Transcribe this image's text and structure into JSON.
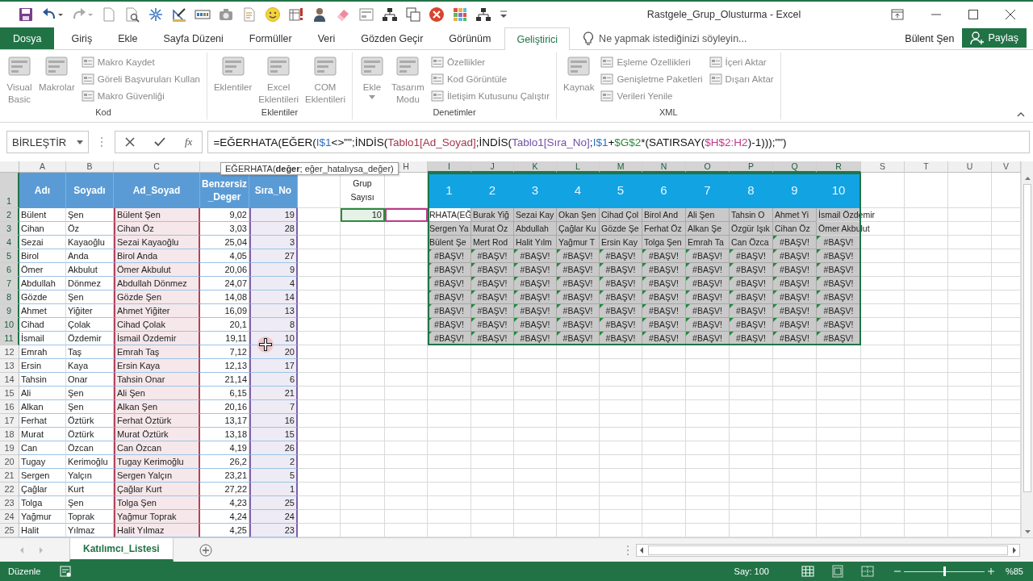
{
  "window": {
    "title": "Rastgele_Grup_Olusturma - Excel",
    "user": "Bülent Şen",
    "share_button": "Paylaş"
  },
  "ribbon_tabs": [
    {
      "label": "Dosya",
      "kind": "file",
      "selected": false
    },
    {
      "label": "Giriş",
      "kind": "tab",
      "selected": false
    },
    {
      "label": "Ekle",
      "kind": "tab",
      "selected": false
    },
    {
      "label": "Sayfa Düzeni",
      "kind": "tab",
      "selected": false
    },
    {
      "label": "Formüller",
      "kind": "tab",
      "selected": false
    },
    {
      "label": "Veri",
      "kind": "tab",
      "selected": false
    },
    {
      "label": "Gözden Geçir",
      "kind": "tab",
      "selected": false
    },
    {
      "label": "Görünüm",
      "kind": "tab",
      "selected": false
    },
    {
      "label": "Geliştirici",
      "kind": "tab",
      "selected": true
    }
  ],
  "tell_me": {
    "placeholder": "Ne yapmak istediğinizi söyleyin..."
  },
  "ribbon": {
    "disabled": true,
    "groups": [
      {
        "label": "Kod",
        "items": [
          {
            "kind": "large",
            "label": "Visual\nBasic",
            "menu": false
          },
          {
            "kind": "large",
            "label": "Makrolar",
            "menu": false
          },
          {
            "kind": "stack",
            "items": [
              {
                "label": "Makro Kaydet"
              },
              {
                "label": "Göreli Başvuruları Kullan"
              },
              {
                "label": "Makro Güvenliği"
              }
            ]
          }
        ]
      },
      {
        "label": "Eklentiler",
        "items": [
          {
            "kind": "large",
            "label": "Eklentiler",
            "menu": false
          },
          {
            "kind": "large",
            "label": "Excel\nEklentileri",
            "menu": false
          },
          {
            "kind": "large",
            "label": "COM\nEklentileri",
            "menu": false
          }
        ]
      },
      {
        "label": "Denetimler",
        "items": [
          {
            "kind": "large",
            "label": "Ekle",
            "menu": true
          },
          {
            "kind": "large",
            "label": "Tasarım\nModu",
            "menu": false
          },
          {
            "kind": "stack",
            "items": [
              {
                "label": "Özellikler"
              },
              {
                "label": "Kod Görüntüle"
              },
              {
                "label": "İletişim Kutusunu Çalıştır"
              }
            ]
          }
        ]
      },
      {
        "label": "XML",
        "items": [
          {
            "kind": "large",
            "label": "Kaynak",
            "menu": false
          },
          {
            "kind": "stack",
            "items": [
              {
                "label": "Eşleme Özellikleri"
              },
              {
                "label": "Genişletme Paketleri"
              },
              {
                "label": "Verileri Yenile"
              }
            ]
          },
          {
            "kind": "stack",
            "items": [
              {
                "label": "İçeri Aktar"
              },
              {
                "label": "Dışarı Aktar"
              }
            ]
          }
        ]
      }
    ]
  },
  "formula_bar": {
    "name_box": "BİRLEŞTİR",
    "function_button": "fx",
    "formula": [
      {
        "text": "=EĞERHATA(EĞER("
      },
      {
        "text": "I$1",
        "color": "#2e6fc0"
      },
      {
        "text": "<>\"\";İNDİS("
      },
      {
        "text": "Tablo1[Ad_Soyad]",
        "color": "#a3364e"
      },
      {
        "text": ";İNDİS("
      },
      {
        "text": "Tablo1[Sıra_No]",
        "color": "#7450a8"
      },
      {
        "text": ";"
      },
      {
        "text": "I$1",
        "color": "#2e6fc0"
      },
      {
        "text": "+"
      },
      {
        "text": "$G$2",
        "color": "#2d8a3c"
      },
      {
        "text": "*(SATIRSAY("
      },
      {
        "text": "$H$2:H2",
        "color": "#c0398a"
      },
      {
        "text": ")-1)));\"\")"
      }
    ]
  },
  "tooltip": "EĞERHATA(**değer**; eğer_hatalıysa_değer)",
  "sheet": {
    "columns": [
      {
        "label": "A",
        "selected": false
      },
      {
        "label": "B",
        "selected": false
      },
      {
        "label": "C",
        "selected": false
      },
      {
        "selected": false
      },
      {
        "selected": false
      },
      {
        "selected": false
      },
      {
        "selected": false
      },
      {
        "label": "H",
        "selected": false
      },
      {
        "label": "I",
        "selected": true
      },
      {
        "label": "J",
        "selected": true
      },
      {
        "label": "K",
        "selected": true
      },
      {
        "label": "L",
        "selected": true
      },
      {
        "label": "M",
        "selected": true
      },
      {
        "label": "N",
        "selected": true
      },
      {
        "label": "O",
        "selected": true
      },
      {
        "label": "P",
        "selected": true
      },
      {
        "label": "Q",
        "selected": true
      },
      {
        "label": "R",
        "selected": true
      },
      {
        "label": "S",
        "selected": false
      },
      {
        "label": "T",
        "selected": false
      },
      {
        "label": "U",
        "selected": false
      },
      {
        "label": "V",
        "selected": false
      }
    ],
    "rows": [
      {
        "label": "1",
        "selected": true
      },
      {
        "label": "2",
        "selected": true
      },
      {
        "label": "3",
        "selected": true
      },
      {
        "label": "4",
        "selected": true
      },
      {
        "label": "5",
        "selected": true
      },
      {
        "label": "6",
        "selected": true
      },
      {
        "label": "7",
        "selected": true
      },
      {
        "label": "8",
        "selected": true
      },
      {
        "label": "9",
        "selected": true
      },
      {
        "label": "10",
        "selected": true
      },
      {
        "label": "11",
        "selected": true
      },
      {
        "label": "12",
        "selected": false
      },
      {
        "label": "13",
        "selected": false
      },
      {
        "label": "14",
        "selected": false
      },
      {
        "label": "15",
        "selected": false
      },
      {
        "label": "16",
        "selected": false
      },
      {
        "label": "17",
        "selected": false
      },
      {
        "label": "18",
        "selected": false
      },
      {
        "label": "19",
        "selected": false
      },
      {
        "label": "20",
        "selected": false
      },
      {
        "label": "21",
        "selected": false
      },
      {
        "label": "22",
        "selected": false
      },
      {
        "label": "23",
        "selected": false
      },
      {
        "label": "24",
        "selected": false
      },
      {
        "label": "25",
        "selected": false
      }
    ],
    "table": {
      "headers": [
        {
          "text": "Adı"
        },
        {
          "text": "Soyadı"
        },
        {
          "text": "Ad_Soyad",
          "color": "#b2435a"
        },
        {
          "text": "Benzersiz\n_Deger"
        },
        {
          "text": "Sıra_No",
          "color": "#7e62ad"
        }
      ],
      "rows": [
        [
          "Bülent",
          "Şen",
          "Bülent Şen",
          "9,02",
          "19"
        ],
        [
          "Cihan",
          "Öz",
          "Cihan Öz",
          "3,03",
          "28"
        ],
        [
          "Sezai",
          "Kayaoğlu",
          "Sezai Kayaoğlu",
          "25,04",
          "3"
        ],
        [
          "Birol",
          "Anda",
          "Birol Anda",
          "4,05",
          "27"
        ],
        [
          "Ömer",
          "Akbulut",
          "Ömer Akbulut",
          "20,06",
          "9"
        ],
        [
          "Abdullah",
          "Dönmez",
          "Abdullah Dönmez",
          "24,07",
          "4"
        ],
        [
          "Gözde",
          "Şen",
          "Gözde Şen",
          "14,08",
          "14"
        ],
        [
          "Ahmet",
          "Yiğiter",
          "Ahmet Yiğiter",
          "16,09",
          "13"
        ],
        [
          "Cihad",
          "Çolak",
          "Cihad Çolak",
          "20,1",
          "8"
        ],
        [
          "İsmail",
          "Özdemir",
          "İsmail Özdemir",
          "19,11",
          "10"
        ],
        [
          "Emrah",
          "Taş",
          "Emrah Taş",
          "7,12",
          "20"
        ],
        [
          "Ersin",
          "Kaya",
          "Ersin Kaya",
          "12,13",
          "17"
        ],
        [
          "Tahsin",
          "Onar",
          "Tahsin Onar",
          "21,14",
          "6"
        ],
        [
          "Ali",
          "Şen",
          "Ali Şen",
          "6,15",
          "21"
        ],
        [
          "Alkan",
          "Şen",
          "Alkan Şen",
          "20,16",
          "7"
        ],
        [
          "Ferhat",
          "Öztürk",
          "Ferhat Öztürk",
          "13,17",
          "16"
        ],
        [
          "Murat",
          "Öztürk",
          "Murat Öztürk",
          "13,18",
          "15"
        ],
        [
          "Can",
          "Özcan",
          "Can Özcan",
          "4,19",
          "26"
        ],
        [
          "Tugay",
          "Kerimoğlu",
          "Tugay Kerimoğlu",
          "26,2",
          "2"
        ],
        [
          "Sergen",
          "Yalçın",
          "Sergen Yalçın",
          "23,21",
          "5"
        ],
        [
          "Çağlar",
          "Kurt",
          "Çağlar Kurt",
          "27,22",
          "1"
        ],
        [
          "Tolga",
          "Şen",
          "Tolga Şen",
          "4,23",
          "25"
        ],
        [
          "Yağmur",
          "Toprak",
          "Yağmur Toprak",
          "4,24",
          "24"
        ],
        [
          "Halit",
          "Yılmaz",
          "Halit Yılmaz",
          "4,25",
          "23"
        ]
      ]
    },
    "group_count": {
      "label": "Grup\nSayısı",
      "value": "10"
    },
    "groups": {
      "headers": [
        "1",
        "2",
        "3",
        "4",
        "5",
        "6",
        "7",
        "8",
        "9",
        "10"
      ],
      "rows": [
        [
          {
            "text": "RHATA(EĞ",
            "kind": "editing"
          },
          {
            "text": "Burak Yiğ",
            "kind": "text"
          },
          {
            "text": "Sezai Kay",
            "kind": "text"
          },
          {
            "text": "Okan Şen",
            "kind": "text"
          },
          {
            "text": "Cihad Çol",
            "kind": "text"
          },
          {
            "text": "Birol And",
            "kind": "text"
          },
          {
            "text": "Ali Şen",
            "kind": "text"
          },
          {
            "text": "Tahsin O",
            "kind": "text"
          },
          {
            "text": "Ahmet Yi",
            "kind": "text"
          },
          {
            "text": "İsmail Özdemir",
            "kind": "overflow"
          }
        ],
        [
          {
            "text": "Sergen Ya",
            "kind": "text"
          },
          {
            "text": "Murat Öz",
            "kind": "text"
          },
          {
            "text": "Abdullah",
            "kind": "text"
          },
          {
            "text": "Çağlar Ku",
            "kind": "text"
          },
          {
            "text": "Gözde Şe",
            "kind": "text"
          },
          {
            "text": "Ferhat Öz",
            "kind": "text"
          },
          {
            "text": "Alkan Şe",
            "kind": "text"
          },
          {
            "text": "Özgür Işık",
            "kind": "text"
          },
          {
            "text": "Cihan Öz",
            "kind": "text"
          },
          {
            "text": "Ömer Akbulut",
            "kind": "overflow"
          }
        ],
        [
          {
            "text": "Bülent Şe",
            "kind": "text"
          },
          {
            "text": "Mert Rod",
            "kind": "text"
          },
          {
            "text": "Halit Yılm",
            "kind": "text"
          },
          {
            "text": "Yağmur T",
            "kind": "text"
          },
          {
            "text": "Ersin Kay",
            "kind": "text"
          },
          {
            "text": "Tolga Şen",
            "kind": "text"
          },
          {
            "text": "Emrah Ta",
            "kind": "text"
          },
          {
            "text": "Can Özca",
            "kind": "text"
          },
          {
            "text": "#BAŞV!",
            "kind": "error"
          },
          {
            "text": "#BAŞV!",
            "kind": "error"
          }
        ],
        [
          {
            "text": "#BAŞV!",
            "kind": "error"
          },
          {
            "text": "#BAŞV!",
            "kind": "error"
          },
          {
            "text": "#BAŞV!",
            "kind": "error"
          },
          {
            "text": "#BAŞV!",
            "kind": "error"
          },
          {
            "text": "#BAŞV!",
            "kind": "error"
          },
          {
            "text": "#BAŞV!",
            "kind": "error"
          },
          {
            "text": "#BAŞV!",
            "kind": "error"
          },
          {
            "text": "#BAŞV!",
            "kind": "error"
          },
          {
            "text": "#BAŞV!",
            "kind": "error"
          },
          {
            "text": "#BAŞV!",
            "kind": "error"
          }
        ],
        [
          {
            "text": "#BAŞV!",
            "kind": "error"
          },
          {
            "text": "#BAŞV!",
            "kind": "error"
          },
          {
            "text": "#BAŞV!",
            "kind": "error"
          },
          {
            "text": "#BAŞV!",
            "kind": "error"
          },
          {
            "text": "#BAŞV!",
            "kind": "error"
          },
          {
            "text": "#BAŞV!",
            "kind": "error"
          },
          {
            "text": "#BAŞV!",
            "kind": "error"
          },
          {
            "text": "#BAŞV!",
            "kind": "error"
          },
          {
            "text": "#BAŞV!",
            "kind": "error"
          },
          {
            "text": "#BAŞV!",
            "kind": "error"
          }
        ],
        [
          {
            "text": "#BAŞV!",
            "kind": "error"
          },
          {
            "text": "#BAŞV!",
            "kind": "error"
          },
          {
            "text": "#BAŞV!",
            "kind": "error"
          },
          {
            "text": "#BAŞV!",
            "kind": "error"
          },
          {
            "text": "#BAŞV!",
            "kind": "error"
          },
          {
            "text": "#BAŞV!",
            "kind": "error"
          },
          {
            "text": "#BAŞV!",
            "kind": "error"
          },
          {
            "text": "#BAŞV!",
            "kind": "error"
          },
          {
            "text": "#BAŞV!",
            "kind": "error"
          },
          {
            "text": "#BAŞV!",
            "kind": "error"
          }
        ],
        [
          {
            "text": "#BAŞV!",
            "kind": "error"
          },
          {
            "text": "#BAŞV!",
            "kind": "error"
          },
          {
            "text": "#BAŞV!",
            "kind": "error"
          },
          {
            "text": "#BAŞV!",
            "kind": "error"
          },
          {
            "text": "#BAŞV!",
            "kind": "error"
          },
          {
            "text": "#BAŞV!",
            "kind": "error"
          },
          {
            "text": "#BAŞV!",
            "kind": "error"
          },
          {
            "text": "#BAŞV!",
            "kind": "error"
          },
          {
            "text": "#BAŞV!",
            "kind": "error"
          },
          {
            "text": "#BAŞV!",
            "kind": "error"
          }
        ],
        [
          {
            "text": "#BAŞV!",
            "kind": "error"
          },
          {
            "text": "#BAŞV!",
            "kind": "error"
          },
          {
            "text": "#BAŞV!",
            "kind": "error"
          },
          {
            "text": "#BAŞV!",
            "kind": "error"
          },
          {
            "text": "#BAŞV!",
            "kind": "error"
          },
          {
            "text": "#BAŞV!",
            "kind": "error"
          },
          {
            "text": "#BAŞV!",
            "kind": "error"
          },
          {
            "text": "#BAŞV!",
            "kind": "error"
          },
          {
            "text": "#BAŞV!",
            "kind": "error"
          },
          {
            "text": "#BAŞV!",
            "kind": "error"
          }
        ],
        [
          {
            "text": "#BAŞV!",
            "kind": "error"
          },
          {
            "text": "#BAŞV!",
            "kind": "error"
          },
          {
            "text": "#BAŞV!",
            "kind": "error"
          },
          {
            "text": "#BAŞV!",
            "kind": "error"
          },
          {
            "text": "#BAŞV!",
            "kind": "error"
          },
          {
            "text": "#BAŞV!",
            "kind": "error"
          },
          {
            "text": "#BAŞV!",
            "kind": "error"
          },
          {
            "text": "#BAŞV!",
            "kind": "error"
          },
          {
            "text": "#BAŞV!",
            "kind": "error"
          },
          {
            "text": "#BAŞV!",
            "kind": "error"
          }
        ],
        [
          {
            "text": "#BAŞV!",
            "kind": "error"
          },
          {
            "text": "#BAŞV!",
            "kind": "error"
          },
          {
            "text": "#BAŞV!",
            "kind": "error"
          },
          {
            "text": "#BAŞV!",
            "kind": "error"
          },
          {
            "text": "#BAŞV!",
            "kind": "error"
          },
          {
            "text": "#BAŞV!",
            "kind": "error"
          },
          {
            "text": "#BAŞV!",
            "kind": "error"
          },
          {
            "text": "#BAŞV!",
            "kind": "error"
          },
          {
            "text": "#BAŞV!",
            "kind": "error"
          },
          {
            "text": "#BAŞV!",
            "kind": "error"
          }
        ]
      ]
    }
  },
  "sheet_tabs": [
    {
      "label": "Katılımcı_Listesi",
      "selected": true
    }
  ],
  "status_bar": {
    "mode": "Düzenle",
    "count": "Say: 100",
    "views": [
      {
        "selected": true
      },
      {
        "selected": false
      },
      {
        "selected": false
      }
    ],
    "zoom": {
      "level": 0.5,
      "reading": "%85"
    }
  }
}
